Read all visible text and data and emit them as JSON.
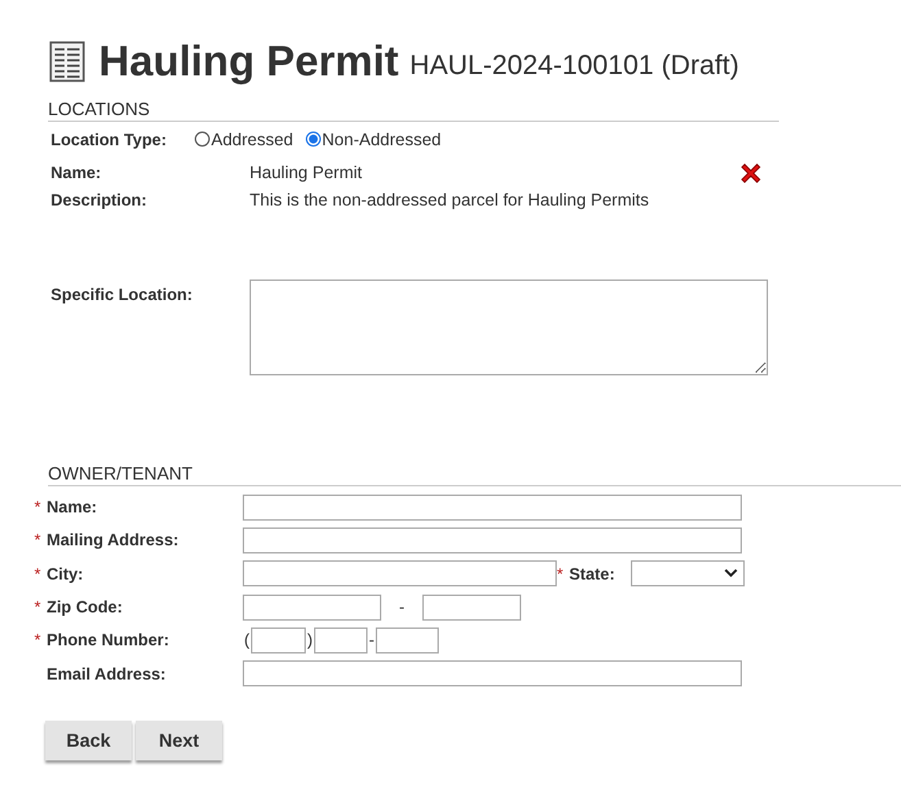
{
  "header": {
    "title": "Hauling Permit",
    "record": "HAUL-2024-100101 (Draft)"
  },
  "locations": {
    "heading": "LOCATIONS",
    "type_label": "Location Type:",
    "options": [
      {
        "label": "Addressed",
        "selected": false
      },
      {
        "label": "Non-Addressed",
        "selected": true
      }
    ],
    "name_label": "Name:",
    "name": "Hauling Permit",
    "description_label": "Description:",
    "description": "This is the non-addressed parcel for Hauling Permits",
    "specific_label": "Specific Location:"
  },
  "owner": {
    "heading": "OWNER/TENANT",
    "fields": [
      {
        "kind": "text",
        "mark": "*",
        "label": "Name:"
      },
      {
        "kind": "text",
        "mark": "*",
        "label": "Mailing Address:"
      },
      {
        "kind": "city",
        "mark": "*",
        "label": "City:",
        "state_mark": "*",
        "state_label": "State:"
      },
      {
        "kind": "zip",
        "mark": "*",
        "label": "Zip Code:",
        "separator": "-"
      },
      {
        "kind": "phone",
        "mark": "*",
        "label": "Phone Number:",
        "open": "(",
        "close": ")",
        "separator": "-"
      },
      {
        "kind": "text",
        "label": "Email Address:"
      }
    ]
  },
  "buttons": [
    "Back",
    "Next"
  ]
}
